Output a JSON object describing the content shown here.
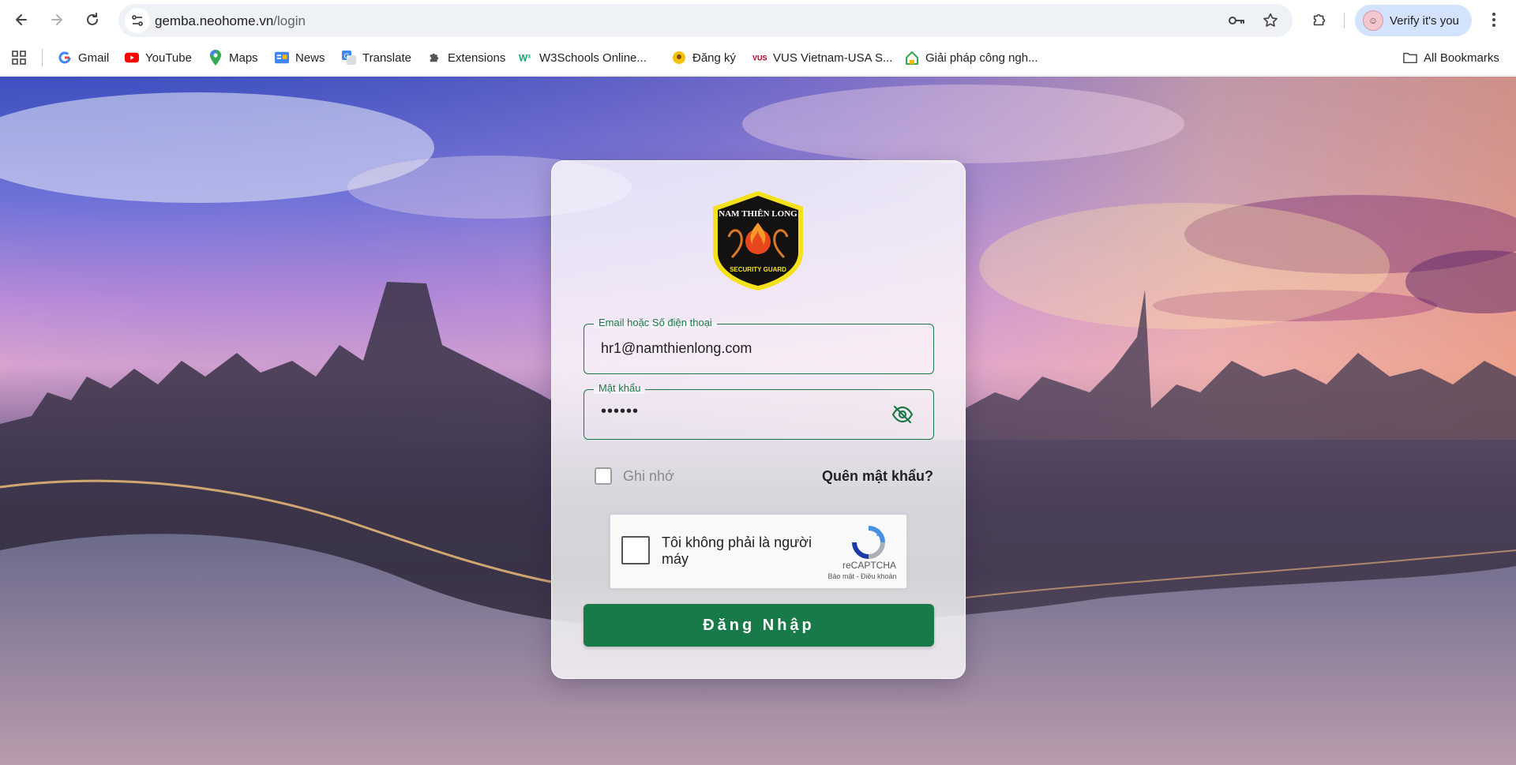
{
  "browser": {
    "url_host": "gemba.neohome.vn",
    "url_path": "/login",
    "profile_label": "Verify it's you",
    "bookmarks": [
      {
        "label": "Gmail",
        "icon": "gmail-icon"
      },
      {
        "label": "YouTube",
        "icon": "youtube-icon"
      },
      {
        "label": "Maps",
        "icon": "maps-icon"
      },
      {
        "label": "News",
        "icon": "news-icon"
      },
      {
        "label": "Translate",
        "icon": "translate-icon"
      },
      {
        "label": "Extensions",
        "icon": "puzzle-icon"
      },
      {
        "label": "W3Schools Online...",
        "icon": "w3schools-icon"
      },
      {
        "label": "Đăng ký",
        "icon": "badge-icon"
      },
      {
        "label": "VUS Vietnam-USA S...",
        "icon": "vus-icon"
      },
      {
        "label": "Giải pháp công ngh...",
        "icon": "house-icon"
      }
    ],
    "all_bookmarks_label": "All Bookmarks"
  },
  "login": {
    "logo": {
      "top_text": "NAM THIÊN LONG",
      "bottom_text": "SECURITY GUARD"
    },
    "email_label": "Email hoặc Số điện thoại",
    "email_value": "hr1@namthienlong.com",
    "password_label": "Mật khẩu",
    "password_value": "••••••",
    "remember_label": "Ghi nhớ",
    "forgot_label": "Quên mật khẩu?",
    "recaptcha": {
      "text": "Tôi không phải là người máy",
      "brand": "reCAPTCHA",
      "links": "Bảo mật - Điều khoản"
    },
    "submit_label": "Đăng Nhập"
  },
  "colors": {
    "primary_green": "#177a48",
    "profile_chip": "#d3e3fd",
    "omnibox": "#eef1f6"
  }
}
